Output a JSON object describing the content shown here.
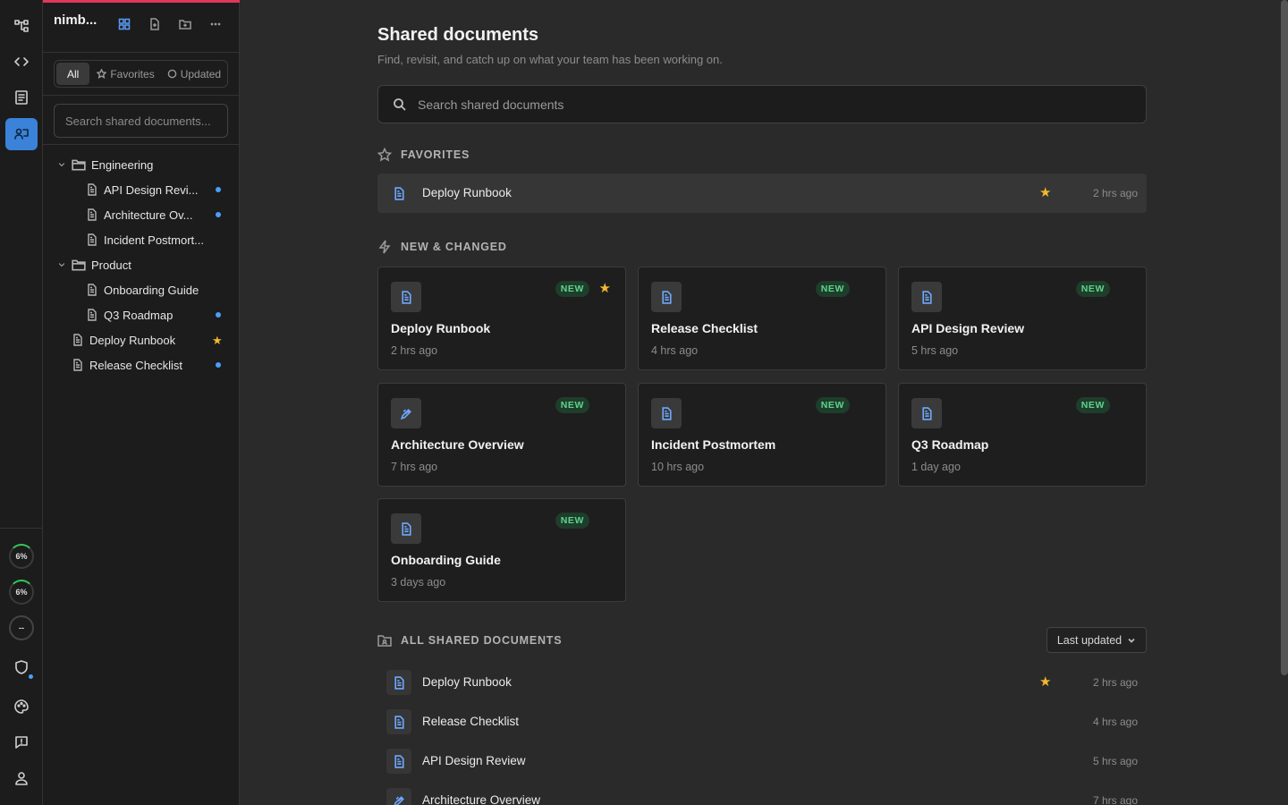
{
  "rail": {
    "icons": [
      "branch-icon",
      "code-icon",
      "notes-icon",
      "shared-docs-icon"
    ],
    "progress": [
      {
        "label": "6%",
        "value": 6
      },
      {
        "label": "6%",
        "value": 6
      },
      {
        "label": "--"
      }
    ]
  },
  "sidebar": {
    "workspace": "nimb...",
    "filters": {
      "all": "All",
      "favorites": "Favorites",
      "updated": "Updated"
    },
    "search_placeholder": "Search shared documents...",
    "tree": [
      {
        "type": "folder",
        "label": "Engineering"
      },
      {
        "type": "doc",
        "label": "API Design Revi...",
        "indicator": "dot"
      },
      {
        "type": "doc",
        "label": "Architecture Ov...",
        "indicator": "dot"
      },
      {
        "type": "doc",
        "label": "Incident Postmort..."
      },
      {
        "type": "folder",
        "label": "Product"
      },
      {
        "type": "doc",
        "label": "Onboarding Guide"
      },
      {
        "type": "doc",
        "label": "Q3 Roadmap",
        "indicator": "dot"
      },
      {
        "type": "doc",
        "label": "Deploy Runbook",
        "indicator": "star"
      },
      {
        "type": "doc",
        "label": "Release Checklist",
        "indicator": "dot"
      }
    ]
  },
  "main": {
    "title": "Shared documents",
    "subtitle": "Find, revisit, and catch up on what your team has been working on.",
    "search_placeholder": "Search shared documents",
    "favorites": {
      "heading": "FAVORITES",
      "items": [
        {
          "label": "Deploy Runbook",
          "time": "2 hrs ago",
          "starred": true
        }
      ]
    },
    "new_changed": {
      "heading": "NEW & CHANGED",
      "badge": "NEW",
      "cards": [
        {
          "title": "Deploy Runbook",
          "time": "2 hrs ago",
          "starred": true
        },
        {
          "title": "Release Checklist",
          "time": "4 hrs ago"
        },
        {
          "title": "API Design Review",
          "time": "5 hrs ago"
        },
        {
          "title": "Architecture Overview",
          "time": "7 hrs ago",
          "icon": "pen"
        },
        {
          "title": "Incident Postmortem",
          "time": "10 hrs ago"
        },
        {
          "title": "Q3 Roadmap",
          "time": "1 day ago"
        },
        {
          "title": "Onboarding Guide",
          "time": "3 days ago"
        }
      ]
    },
    "all_shared": {
      "heading": "ALL SHARED DOCUMENTS",
      "sort_label": "Last updated",
      "items": [
        {
          "label": "Deploy Runbook",
          "time": "2 hrs ago",
          "starred": true
        },
        {
          "label": "Release Checklist",
          "time": "4 hrs ago"
        },
        {
          "label": "API Design Review",
          "time": "5 hrs ago"
        },
        {
          "label": "Architecture Overview",
          "time": "7 hrs ago",
          "icon": "pen"
        }
      ]
    }
  },
  "colors": {
    "accent": "#3b82d9",
    "new_badge": "#5fd38d",
    "star": "#f5b82e",
    "unread_dot": "#4a9eff",
    "top_bar": "#e0375d"
  }
}
